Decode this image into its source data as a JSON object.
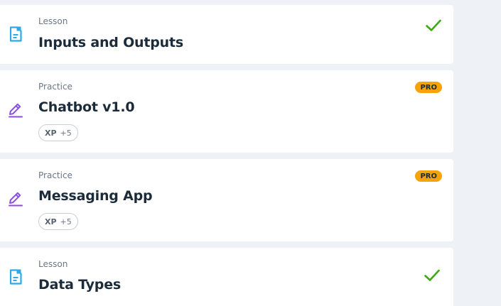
{
  "items": [
    {
      "type": "Lesson",
      "title": "Inputs and Outputs",
      "icon": "lesson-document-icon",
      "status": "completed"
    },
    {
      "type": "Practice",
      "title": "Chatbot v1.0",
      "icon": "practice-pencil-icon",
      "badge": "PRO",
      "xp_label": "XP",
      "xp_value": "+5"
    },
    {
      "type": "Practice",
      "title": "Messaging App",
      "icon": "practice-pencil-icon",
      "badge": "PRO",
      "xp_label": "XP",
      "xp_value": "+5"
    },
    {
      "type": "Lesson",
      "title": "Data Types",
      "icon": "lesson-document-icon",
      "status": "completed"
    }
  ],
  "colors": {
    "lesson_icon": "#2ea8e6",
    "practice_icon": "#8a4ee0",
    "check": "#3fa814",
    "pro_badge": "#f5a30b",
    "background": "#eef1f5"
  }
}
